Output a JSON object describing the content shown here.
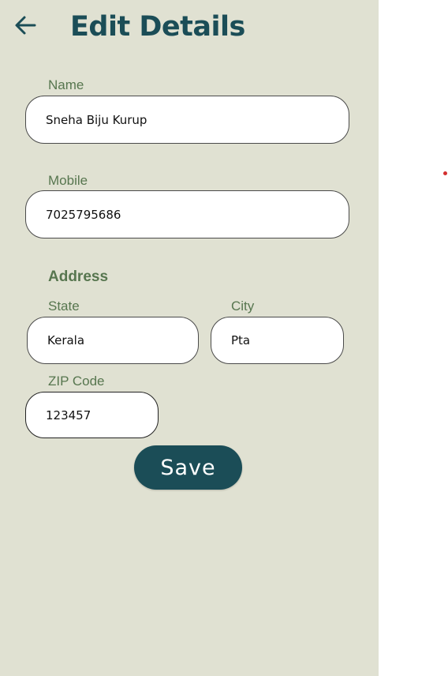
{
  "header": {
    "title": "Edit Details",
    "back_icon": "arrow-left-icon"
  },
  "form": {
    "name": {
      "label": "Name",
      "value": "Sneha Biju Kurup"
    },
    "mobile": {
      "label": "Mobile",
      "value": "7025795686"
    },
    "address_title": "Address",
    "state": {
      "label": "State",
      "value": "Kerala"
    },
    "city": {
      "label": "City",
      "value": "Pta"
    },
    "zip": {
      "label": "ZIP Code",
      "value": "123457"
    }
  },
  "actions": {
    "save_label": "Save"
  },
  "colors": {
    "panel_bg": "#e0e1d2",
    "accent": "#1b4d57",
    "label": "#57764f",
    "indicator_dot": "#d32f2f"
  }
}
